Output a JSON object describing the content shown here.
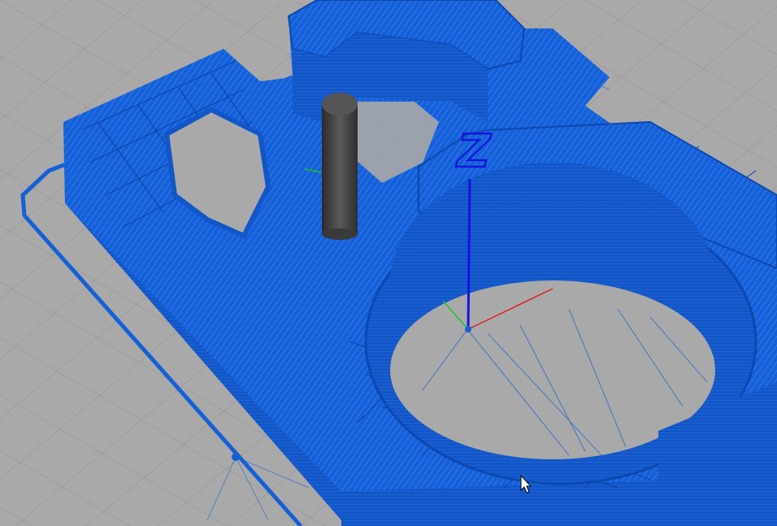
{
  "viewer": {
    "model_color": "#1560d8",
    "model_dark": "#0d48b0",
    "model_light": "#3a82f0",
    "bed_color": "#a9a9a9",
    "grid_color": "#8f8f8f",
    "nozzle_color": "#444444"
  },
  "axes": {
    "z_label": "Z",
    "x_color": "#e02020",
    "y_color": "#20c020",
    "z_color": "#1515e0"
  },
  "icons": {
    "cursor": "mouse-pointer-icon",
    "nozzle": "print-head-cylinder"
  }
}
